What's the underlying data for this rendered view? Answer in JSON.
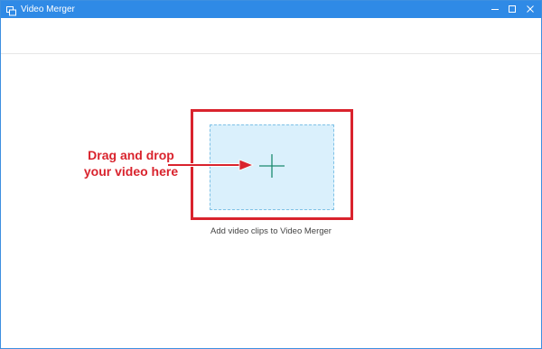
{
  "window": {
    "title": "Video Merger",
    "controls": [
      "minimize-icon",
      "maximize-icon",
      "close-icon"
    ]
  },
  "drop_zone": {
    "icon": "plus-icon",
    "caption": "Add video clips to Video Merger"
  },
  "annotation": {
    "line1": "Drag and drop",
    "line2": "your video here"
  },
  "colors": {
    "titlebar": "#2f8ae6",
    "highlight_border": "#d9232d",
    "drop_zone_fill": "#daf0fc",
    "drop_zone_border": "#7ec1e6",
    "plus": "#1a8a6e"
  }
}
